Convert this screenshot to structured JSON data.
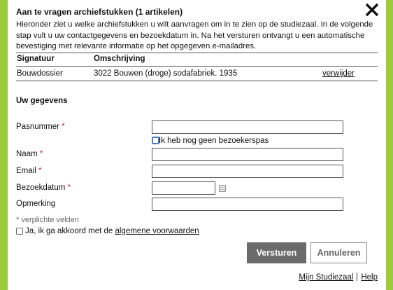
{
  "dialog": {
    "title": "Aan te vragen archiefstukken (1 artikelen)",
    "intro": "Hieronder ziet u welke archiefstukken u wilt aanvragen om in te zien op de studiezaal. In de volgende stap vult u uw contactgegevens en bezoekdatum in. Na het versturen ontvangt u een automatische bevestiging met relevante informatie op het opgegeven e-mailadres.",
    "close_icon": "close-icon"
  },
  "table": {
    "headers": [
      "Signatuur",
      "Omschrijving"
    ],
    "rows": [
      {
        "signatuur": "Bouwdossier",
        "omschrijving": "3022 Bouwen (droge) sodafabriek. 1935",
        "action": "verwijder"
      }
    ]
  },
  "form": {
    "section_title": "Uw gegevens",
    "pasnummer_label": "Pasnummer",
    "no_pass_label": "Ik heb nog geen bezoekerspas",
    "naam_label": "Naam",
    "email_label": "Email",
    "bezoekdatum_label": "Bezoekdatum",
    "opmerking_label": "Opmerking",
    "required_mark": "*",
    "hint": "* verplichte velden",
    "agree_prefix": "Ja, ik ga akkoord met de ",
    "agree_link": "algemene voorwaarden"
  },
  "buttons": {
    "send": "Versturen",
    "cancel": "Annuleren"
  },
  "footer": {
    "link1": "Mijn Studiezaal",
    "link2": "Help"
  },
  "colors": {
    "background": "#9ccb3b",
    "primary_button": "#6b6b6b",
    "required": "#dd2222"
  }
}
